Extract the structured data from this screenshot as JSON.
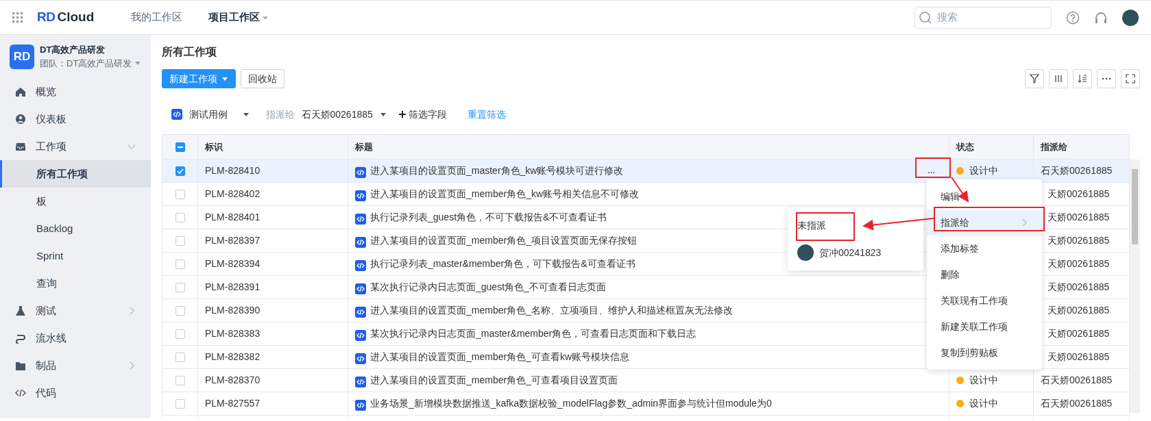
{
  "topbar": {
    "logo_mark": "RD",
    "logo_text": "Cloud",
    "nav": [
      {
        "label": "我的工作区",
        "selected": false,
        "dropdown": false
      },
      {
        "label": "项目工作区",
        "selected": true,
        "dropdown": true
      }
    ],
    "search": {
      "placeholder": "搜索"
    }
  },
  "sidebar": {
    "project": {
      "badge": "RD",
      "name": "DT高效产品研发",
      "team": "团队：DT高效产品研发"
    },
    "items": [
      {
        "label": "概览",
        "selected": false
      },
      {
        "label": "仪表板",
        "selected": false
      },
      {
        "label": "工作项",
        "selected": false,
        "expanded": true,
        "children": [
          {
            "label": "所有工作项",
            "selected": true
          },
          {
            "label": "板",
            "selected": false
          },
          {
            "label": "Backlog",
            "selected": false
          },
          {
            "label": "Sprint",
            "selected": false
          },
          {
            "label": "查询",
            "selected": false
          }
        ]
      },
      {
        "label": "测试",
        "selected": false,
        "expanded": false
      },
      {
        "label": "流水线",
        "selected": false
      },
      {
        "label": "制品",
        "selected": false,
        "expanded": false
      },
      {
        "label": "代码",
        "selected": false
      }
    ]
  },
  "page": {
    "title": "所有工作项",
    "buttons": [
      {
        "label": "新建工作项",
        "primary": true,
        "dropdown": true
      },
      {
        "label": "回收站",
        "primary": false,
        "dropdown": false
      }
    ]
  },
  "filters": {
    "type": "测试用例",
    "assignee_label": "指派给",
    "assignee": "石天娇00261885",
    "add_field": "筛选字段",
    "reset": "重置筛选"
  },
  "table": {
    "columns": [
      "标识",
      "标题",
      "状态",
      "指派给"
    ],
    "header_indeterminate": true,
    "rows": [
      {
        "id": "PLM-828410",
        "title": "进入某项目的设置页面_master角色_kw账号模块可进行修改",
        "more_button": "...",
        "status": "设计中",
        "assignee": "石天娇00261885",
        "checked": true
      },
      {
        "id": "PLM-828402",
        "title": "进入某项目的设置页面_member角色_kw账号相关信息不可修改",
        "assignee": "天娇00261885",
        "checked": false
      },
      {
        "id": "PLM-828401",
        "title": "执行记录列表_guest角色，不可下载报告&不可查看证书",
        "assignee": "天娇00261885",
        "checked": false
      },
      {
        "id": "PLM-828397",
        "title": "进入某项目的设置页面_member角色_项目设置页面无保存按钮",
        "assignee": "天娇00261885",
        "checked": false
      },
      {
        "id": "PLM-828394",
        "title": "执行记录列表_master&member角色，可下载报告&可查看证书",
        "assignee": "天娇00261885",
        "checked": false
      },
      {
        "id": "PLM-828391",
        "title": "某次执行记录内日志页面_guest角色_不可查看日志页面",
        "assignee": "天娇00261885",
        "checked": false
      },
      {
        "id": "PLM-828390",
        "title": "进入某项目的设置页面_member角色_名称、立项项目、维护人和描述框置灰无法修改",
        "assignee": "天娇00261885",
        "checked": false
      },
      {
        "id": "PLM-828383",
        "title": "某次执行记录内日志页面_master&member角色，可查看日志页面和下载日志",
        "assignee": "天娇00261885",
        "checked": false
      },
      {
        "id": "PLM-828382",
        "title": "进入某项目的设置页面_member角色_可查看kw账号模块信息",
        "assignee": "天娇00261885",
        "checked": false
      },
      {
        "id": "PLM-828370",
        "title": "进入某项目的设置页面_member角色_可查看项目设置页面",
        "status": "设计中",
        "assignee": "石天娇00261885",
        "checked": false
      },
      {
        "id": "PLM-827557",
        "title": "业务场景_新增模块数据推送_kafka数据校验_modelFlag参数_admin界面参与统计但module为0",
        "status": "设计中",
        "assignee": "石天娇00261885",
        "checked": false
      }
    ]
  },
  "context_menu": {
    "items": [
      {
        "label": "编辑",
        "selected": false,
        "submenu": false
      },
      {
        "label": "指派给",
        "selected": true,
        "submenu": true
      },
      {
        "label": "添加标签",
        "selected": false,
        "submenu": false
      },
      {
        "label": "删除",
        "selected": false,
        "submenu": false
      },
      {
        "label": "关联现有工作项",
        "selected": false,
        "submenu": false
      },
      {
        "label": "新建关联工作项",
        "selected": false,
        "submenu": false
      },
      {
        "label": "复制到剪贴板",
        "selected": false,
        "submenu": false
      }
    ],
    "submenu": {
      "items": [
        {
          "label": "未指派",
          "avatar": false
        },
        {
          "label": "贺冲00241823",
          "avatar": true
        }
      ]
    }
  }
}
